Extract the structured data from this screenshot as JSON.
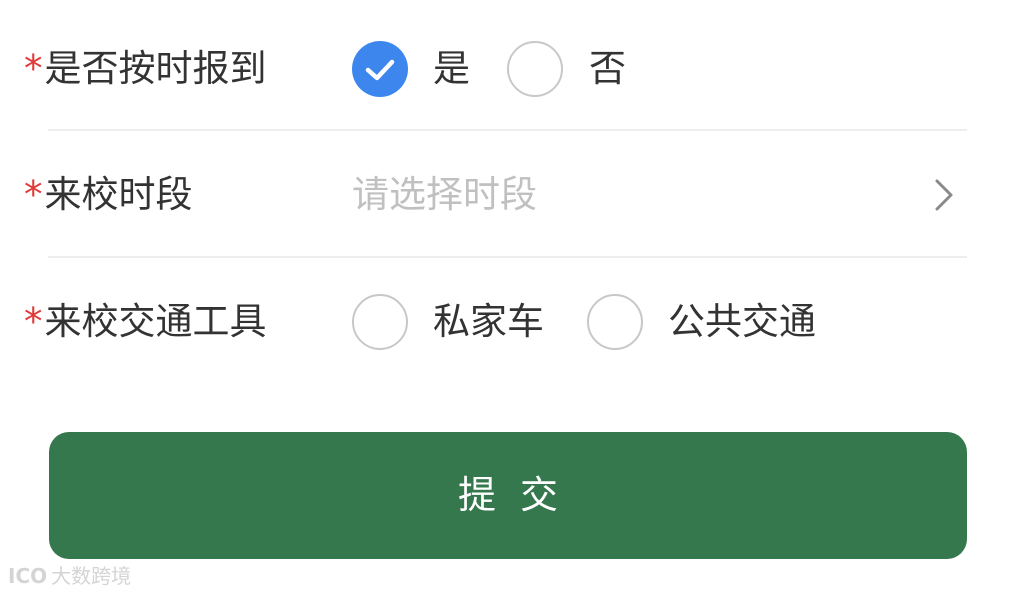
{
  "form": {
    "fields": [
      {
        "label": "是否按时报到",
        "required_mark": "*",
        "options": [
          {
            "label": "是",
            "checked": true
          },
          {
            "label": "否",
            "checked": false
          }
        ]
      },
      {
        "label": "来校时段",
        "required_mark": "*",
        "placeholder": "请选择时段"
      },
      {
        "label": "来校交通工具",
        "required_mark": "*",
        "options": [
          {
            "label": "私家车",
            "checked": false
          },
          {
            "label": "公共交通",
            "checked": false
          }
        ]
      }
    ],
    "submit_label": "提交"
  },
  "watermark": {
    "mark": "ICO",
    "text": "大数跨境"
  },
  "colors": {
    "accent": "#3d86ee",
    "required": "#e03a3a",
    "submit_bg": "#35784d",
    "placeholder": "#c0c0c0",
    "text": "#333333"
  },
  "icons": {
    "checked": "checkmark-icon",
    "chevron": "chevron-right-icon"
  }
}
